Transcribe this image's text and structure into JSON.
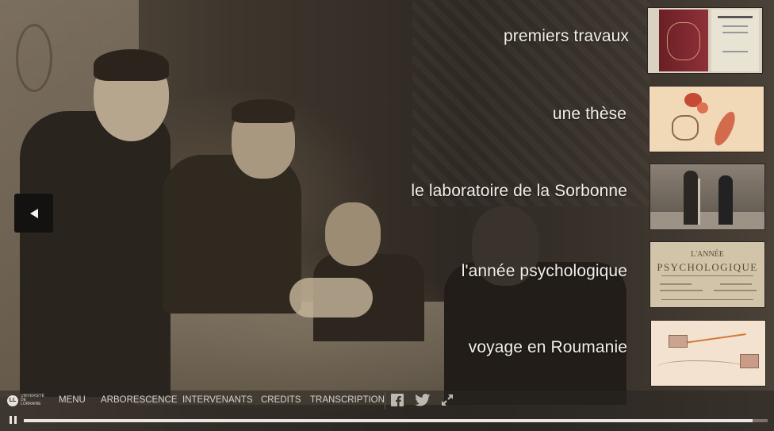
{
  "navigation": {
    "back_button_icon": "left-triangle-icon"
  },
  "items": [
    {
      "label": "premiers travaux"
    },
    {
      "label": "une thèse"
    },
    {
      "label": "le laboratoire de la Sorbonne"
    },
    {
      "label": "l'année psychologique"
    },
    {
      "label": "voyage en Roumanie"
    }
  ],
  "thumbnail_4": {
    "line1": "L'ANNÉE",
    "line2": "PSYCHOLOGIQUE"
  },
  "logo": {
    "initial": "LL",
    "text": "UNIVERSITÉ DE LORRAINE"
  },
  "menu": {
    "menu": "MENU",
    "tree": "ARBORESCENCE",
    "speakers": "INTERVENANTS",
    "credits": "CREDITS",
    "transcription": "TRANSCRIPTION"
  },
  "social": {
    "facebook_icon": "facebook-icon",
    "twitter_icon": "twitter-icon",
    "fullscreen_icon": "fullscreen-icon"
  },
  "player": {
    "progress": 0.98,
    "state": "playing"
  },
  "colors": {
    "label_text": "#f2efe9",
    "bar_text": "#d6d2cb",
    "progress_fill": "#e9e6e1"
  }
}
